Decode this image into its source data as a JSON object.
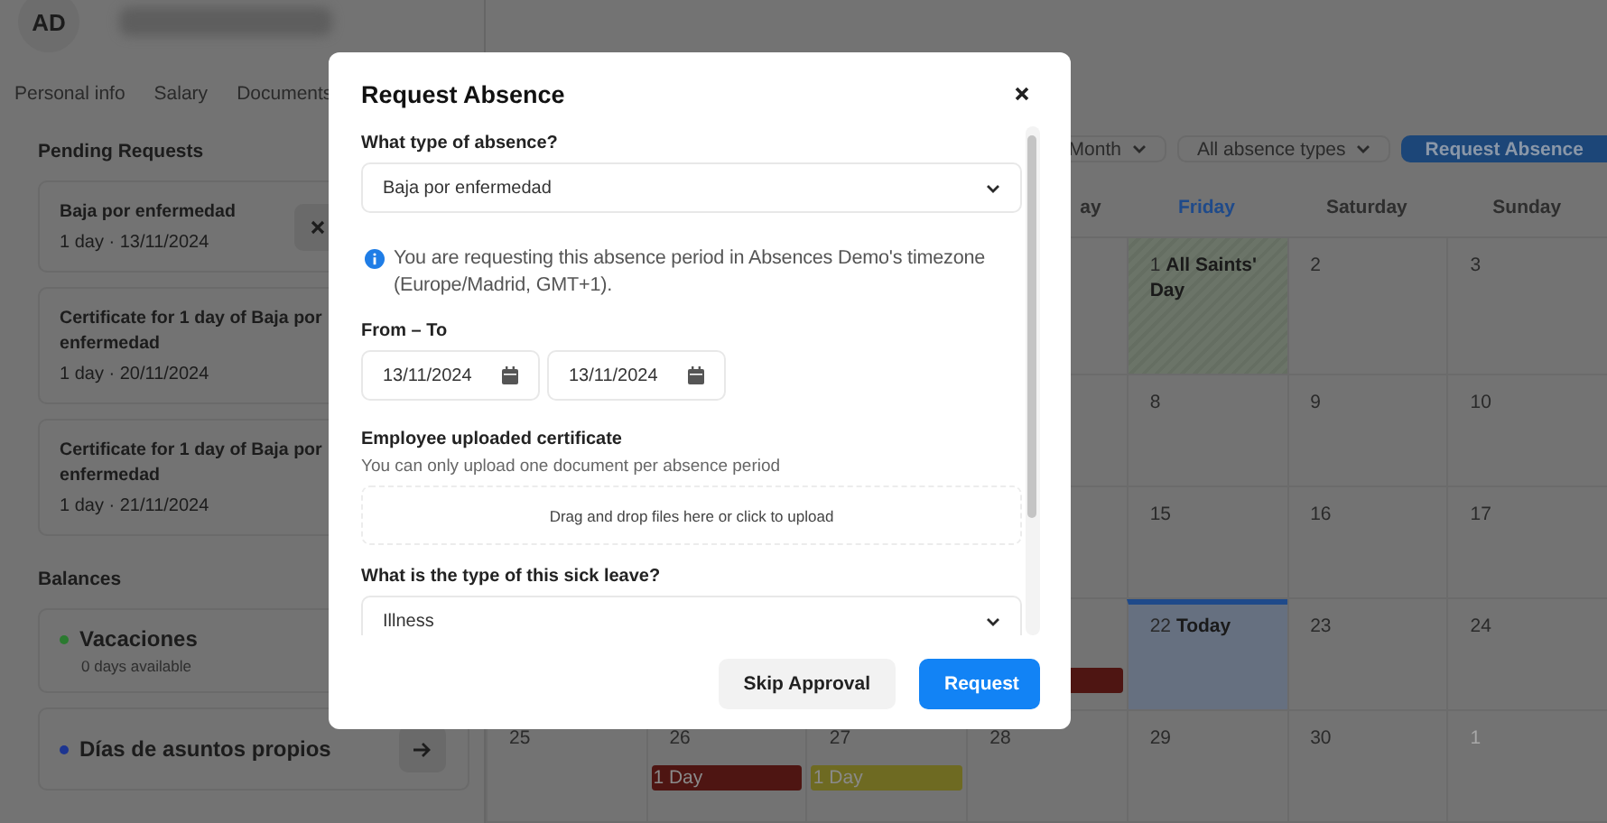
{
  "header": {
    "avatar": "AD",
    "name_blurred": true
  },
  "tabs": [
    {
      "label": "Personal info"
    },
    {
      "label": "Salary"
    },
    {
      "label": "Documents"
    }
  ],
  "pending_requests": {
    "title": "Pending Requests",
    "items": [
      {
        "title": "Baja por enfermedad",
        "detail": "1 day · 13/11/2024",
        "cancellable": true
      },
      {
        "title": "Certificate for 1 day of Baja por enfermedad",
        "detail": "1 day · 20/11/2024",
        "cancellable": false
      },
      {
        "title": "Certificate for 1 day of Baja por enfermedad",
        "detail": "1 day · 21/11/2024",
        "cancellable": false
      }
    ]
  },
  "balances": {
    "title": "Balances",
    "items": [
      {
        "name": "Vacaciones",
        "color": "#2b7a30",
        "detail": "0 days available"
      },
      {
        "name": "Días de asuntos propios",
        "color": "#1d3590",
        "arrow": true
      }
    ]
  },
  "calendar": {
    "toolbar": {
      "view": "Month",
      "filter": "All absence types",
      "button": "Request Absence"
    },
    "weekdays": [
      {
        "label": "ay",
        "clipped": true,
        "selected": false
      },
      {
        "label": "Friday",
        "clipped": false,
        "selected": true
      },
      {
        "label": "Saturday",
        "clipped": false,
        "selected": false
      },
      {
        "label": "Sunday",
        "clipped": false,
        "selected": false
      }
    ],
    "weeks": [
      [
        {
          "label": "1 **All Saints' Day**",
          "kind": "holiday"
        },
        {
          "label": "2",
          "kind": "normal"
        },
        {
          "label": "3",
          "kind": "normal"
        }
      ],
      [
        {
          "label": "8",
          "kind": "normal"
        },
        {
          "label": "9",
          "kind": "normal"
        },
        {
          "label": "10",
          "kind": "normal"
        }
      ],
      [
        {
          "label": "15",
          "kind": "normal"
        },
        {
          "label": "16",
          "kind": "normal"
        },
        {
          "label": "17",
          "kind": "normal"
        }
      ],
      [
        {
          "kind": "normal",
          "events": [
            {
              "color": "#4e1512"
            }
          ]
        },
        {
          "label": "22 **Today**",
          "kind": "today"
        },
        {
          "label": "23",
          "kind": "normal"
        },
        {
          "label": "24",
          "kind": "normal"
        }
      ],
      [
        {
          "label": "25",
          "kind": "normal"
        },
        {
          "label": "26",
          "kind": "normal",
          "events": [
            {
              "label": "1 Day",
              "color": "#4e1512"
            }
          ]
        },
        {
          "label": "27",
          "kind": "normal",
          "events": [
            {
              "label": "1 Day",
              "color": "#6e6a22"
            }
          ]
        },
        {
          "label": "28",
          "kind": "normal"
        },
        {
          "label": "29",
          "kind": "normal"
        },
        {
          "label": "30",
          "kind": "normal"
        },
        {
          "label": "1",
          "kind": "muted"
        }
      ]
    ]
  },
  "modal": {
    "title": "Request Absence",
    "fields": [
      {
        "kind": "select",
        "label": "What type of absence?",
        "value": "Baja por enfermedad"
      },
      {
        "kind": "info",
        "text": "You are requesting this absence period in Absences Demo's timezone (Europe/Madrid, GMT+1)."
      },
      {
        "kind": "dates",
        "label": "From – To",
        "from": "13/11/2024",
        "to": "13/11/2024"
      },
      {
        "kind": "upload",
        "label": "Employee uploaded certificate",
        "hint": "You can only upload one document per absence period",
        "drop": "Drag and drop files here or click to upload"
      },
      {
        "kind": "select",
        "label": "What is the type of this sick leave?",
        "value": "Illness"
      }
    ],
    "buttons": [
      {
        "label": "Skip Approval",
        "kind": "secondary"
      },
      {
        "label": "Request",
        "kind": "primary"
      }
    ]
  }
}
